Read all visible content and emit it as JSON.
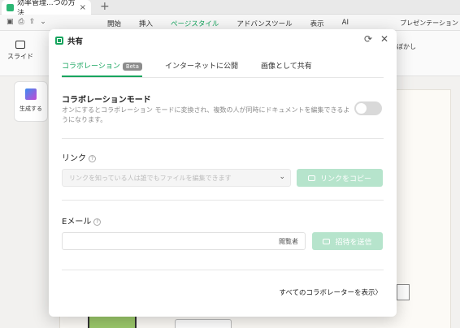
{
  "browser": {
    "tab_title": "効率管理...つの方法",
    "close": "×",
    "new_tab": "+"
  },
  "quick_icons": {
    "save": "▣",
    "print": "⎙",
    "export": "⇪",
    "more": "⌄"
  },
  "menu": {
    "items": [
      "開始",
      "挿入",
      "ページスタイル",
      "アドバンスツール",
      "表示",
      "AI"
    ],
    "active_index": 2,
    "presentation": "プレゼンテーション"
  },
  "ribbon": {
    "slide_label": "スライド",
    "right_label": "ぼかし"
  },
  "sidebar": {
    "generate_label": "生成する"
  },
  "dialog": {
    "title": "共有",
    "tabs": [
      {
        "label": "コラボレーション",
        "badge": "Beta"
      },
      {
        "label": "インターネットに公開"
      },
      {
        "label": "画像として共有"
      }
    ],
    "collab": {
      "title": "コラボレーションモード",
      "description": "オンにするとコラボレーション モードに変換され、複数の人が同時にドキュメントを編集できるようになります。",
      "toggle_on": false
    },
    "link": {
      "title": "リンク",
      "help": "?",
      "placeholder": "リンクを知っている人は誰でもファイルを編集できます",
      "chevron": "⌄",
      "copy_button": "リンクをコピー"
    },
    "email": {
      "title": "Eメール",
      "help": "?",
      "role": "閲覧者",
      "invite_button": "招待を送信"
    },
    "footer": {
      "view_all": "すべてのコラボレーターを表示",
      "arrow": "〉"
    }
  },
  "colors": {
    "accent": "#18a55f",
    "button_disabled": "#b6e4cc"
  }
}
